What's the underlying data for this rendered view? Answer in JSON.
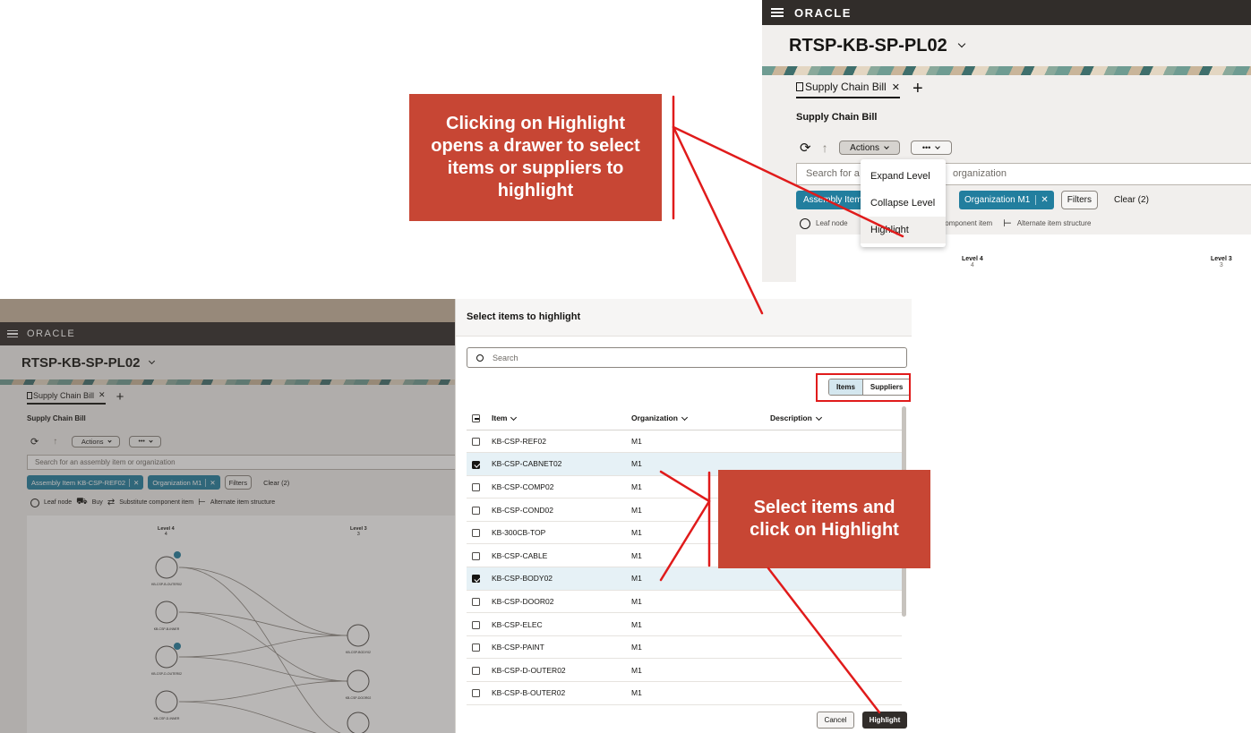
{
  "app": {
    "logo": "ORACLE",
    "page_title": "RTSP-KB-SP-PL02",
    "tab_label": "Supply Chain Bill",
    "subtitle": "Supply Chain Bill",
    "actions_label": "Actions",
    "more_label": "•••",
    "search_placeholder": "Search for an assembly item or organization",
    "chip_assembly": "Assembly Item KB-CSP-REF02",
    "chip_org": "Organization M1",
    "filters_label": "Filters",
    "clear_label": "Clear (2)",
    "legend": {
      "leaf": "Leaf node",
      "buy": "Buy",
      "substitute": "Substitute component item",
      "alternate": "Alternate item structure"
    },
    "levels": [
      "Level 4",
      "Level 3"
    ],
    "level_counts": [
      "4",
      "3"
    ]
  },
  "top_snippet": {
    "search_left": "Search for a",
    "search_right": "organization",
    "chip_assembly": "Assembly Item",
    "legend_leaf": "Leaf node",
    "legend_sub": "e component item"
  },
  "actions_menu": [
    "Expand Level",
    "Collapse Level",
    "Highlight"
  ],
  "callouts": {
    "top": "Clicking on Highlight opens a drawer to select items or suppliers to highlight",
    "bottom": "Select items and click on Highlight"
  },
  "drawer": {
    "title": "Select items to highlight",
    "search_placeholder": "Search",
    "segment": [
      "Items",
      "Suppliers"
    ],
    "columns": [
      "Item",
      "Organization",
      "Description"
    ],
    "rows": [
      {
        "item": "KB-CSP-REF02",
        "org": "M1",
        "selected": false
      },
      {
        "item": "KB-CSP-CABNET02",
        "org": "M1",
        "selected": true
      },
      {
        "item": "KB-CSP-COMP02",
        "org": "M1",
        "selected": false
      },
      {
        "item": "KB-CSP-COND02",
        "org": "M1",
        "selected": false
      },
      {
        "item": "KB-300CB-TOP",
        "org": "M1",
        "selected": false
      },
      {
        "item": "KB-CSP-CABLE",
        "org": "M1",
        "selected": false
      },
      {
        "item": "KB-CSP-BODY02",
        "org": "M1",
        "selected": true
      },
      {
        "item": "KB-CSP-DOOR02",
        "org": "M1",
        "selected": false
      },
      {
        "item": "KB-CSP-ELEC",
        "org": "M1",
        "selected": false
      },
      {
        "item": "KB-CSP-PAINT",
        "org": "M1",
        "selected": false
      },
      {
        "item": "KB-CSP-D-OUTER02",
        "org": "M1",
        "selected": false
      },
      {
        "item": "KB-CSP-B-OUTER02",
        "org": "M1",
        "selected": false
      }
    ],
    "cancel_label": "Cancel",
    "highlight_label": "Highlight"
  },
  "graph_nodes": {
    "n1": "KB-CSP-B-OUTER02",
    "n2": "KB-CSP-B-INNER",
    "n3": "KB-CSP-D-OUTER02",
    "n4": "KB-CSP-D-INNER",
    "r1": "KB-CSP-BODY02",
    "r2": "KB-CSP-DOOR02",
    "badge": "1"
  },
  "colors": {
    "callout": "#c74634",
    "annotation_red": "#e01b1b",
    "chip_teal": "#227e9e",
    "topbar": "#312d2a"
  }
}
